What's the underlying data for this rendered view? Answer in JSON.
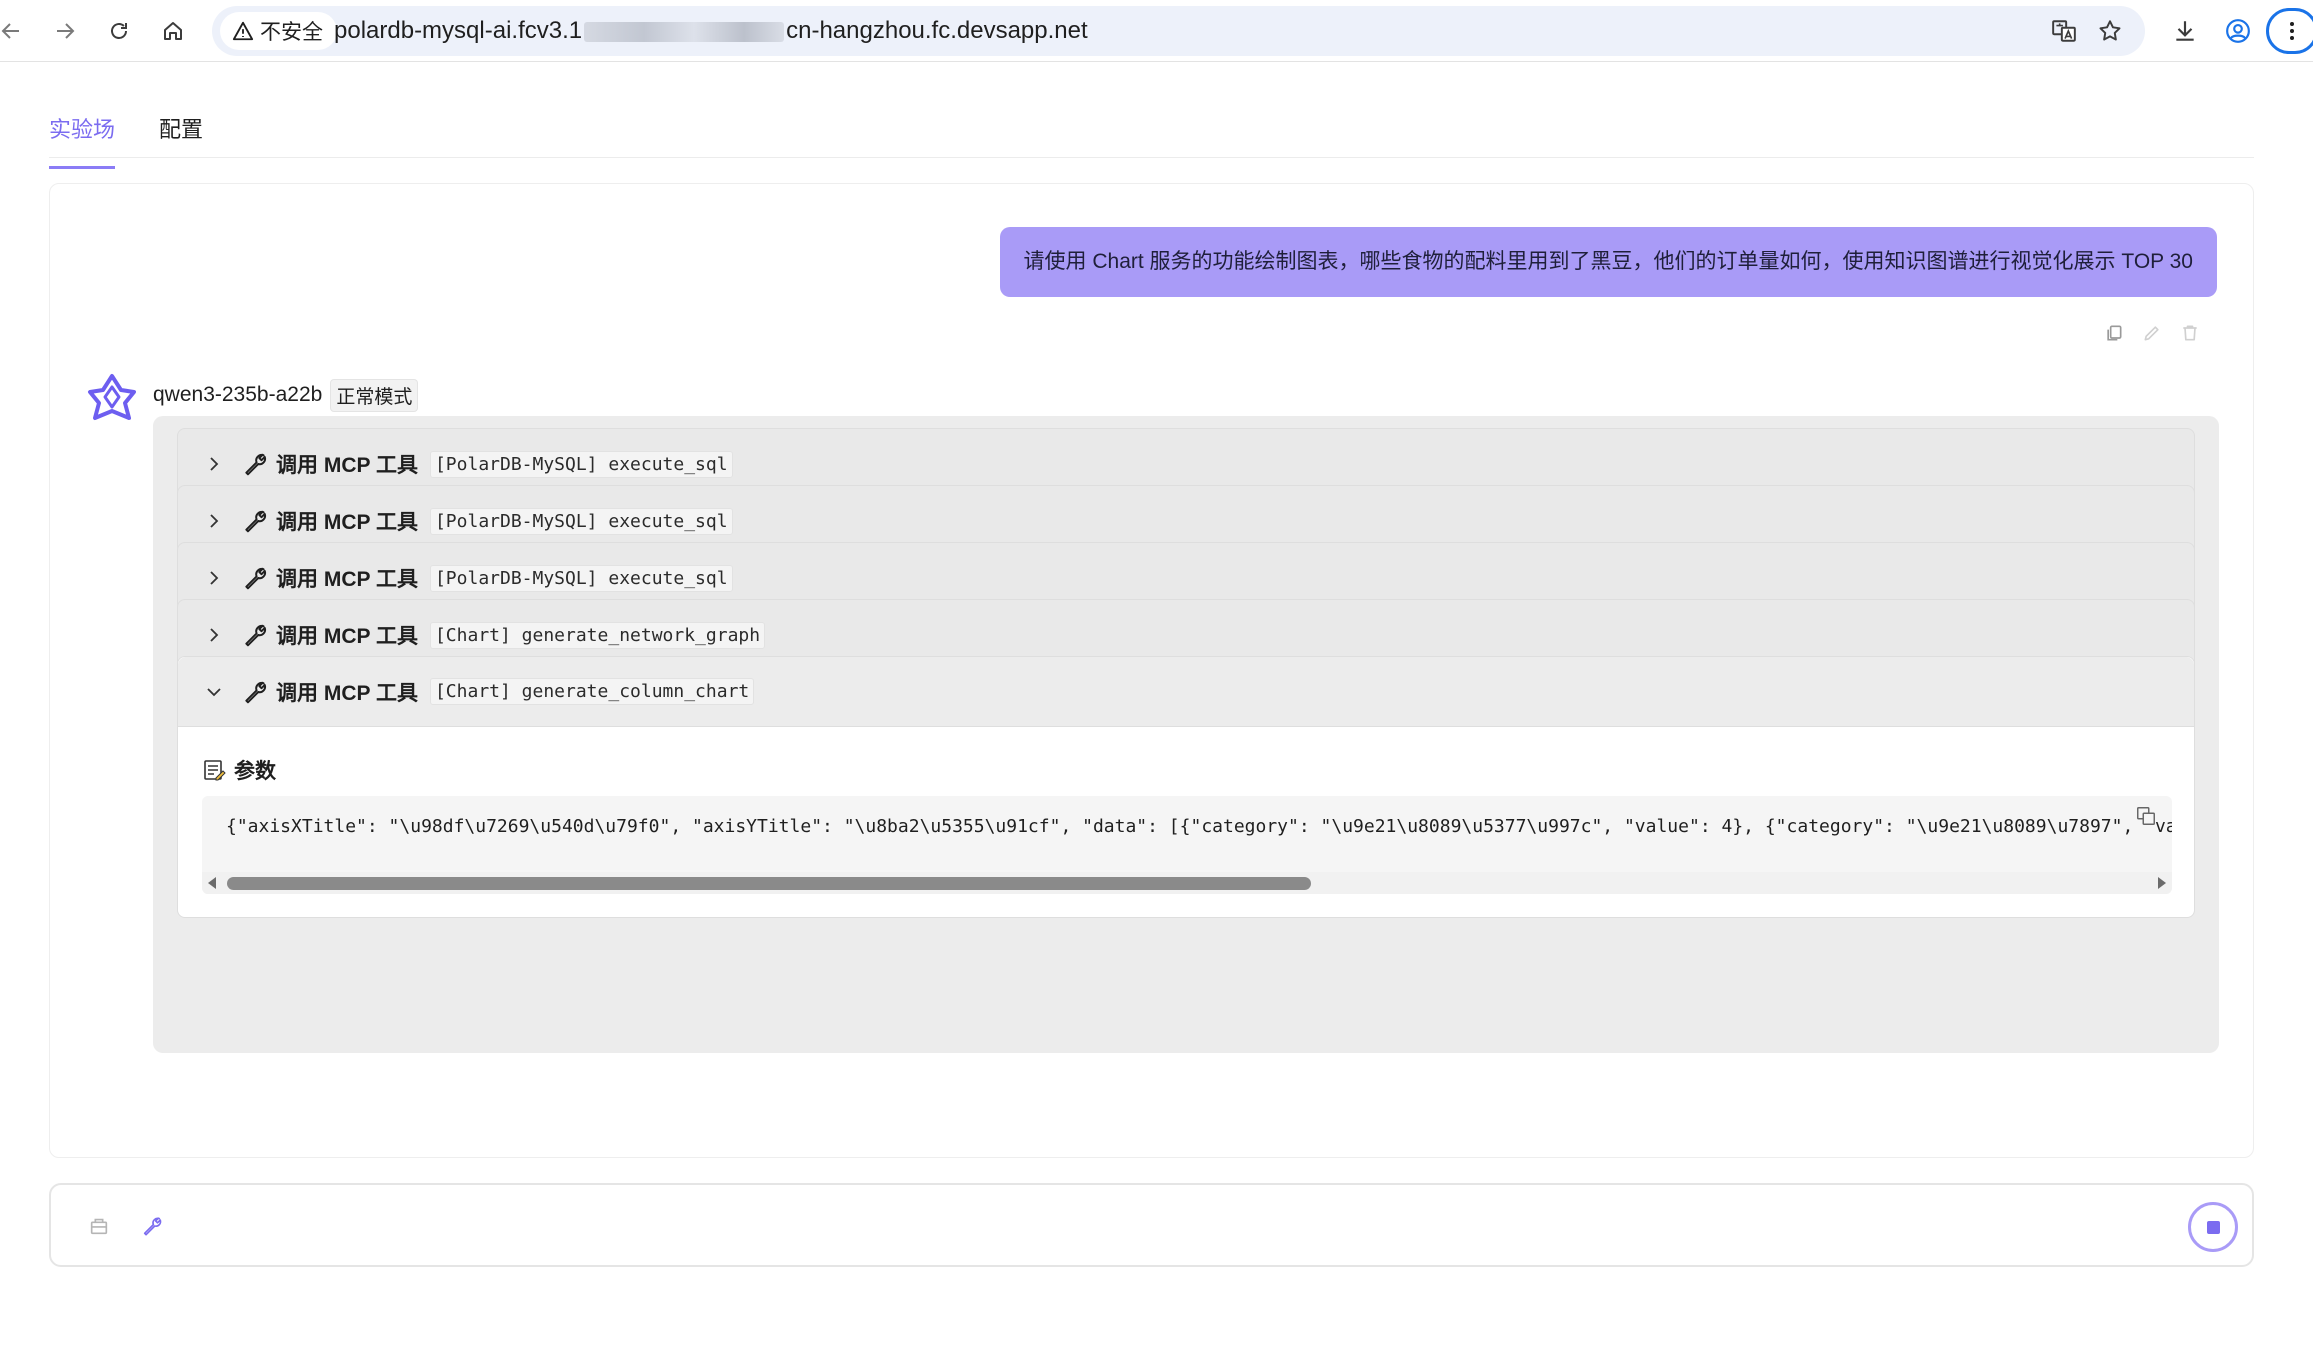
{
  "browser": {
    "security_label": "不安全",
    "url_prefix": "polardb-mysql-ai.fcv3.1",
    "url_suffix": "cn-hangzhou.fc.devsapp.net"
  },
  "tabs": [
    {
      "label": "实验场",
      "active": true
    },
    {
      "label": "配置",
      "active": false
    }
  ],
  "chat": {
    "user_message": "请使用 Chart 服务的功能绘制图表，哪些食物的配料里用到了黑豆，他们的订单量如何，使用知识图谱进行视觉化展示 TOP 30",
    "model_name": "qwen3-235b-a22b",
    "mode_badge": "正常模式",
    "tool_calls": [
      {
        "title": "调用 MCP 工具",
        "tool": "[PolarDB-MySQL] execute_sql",
        "expanded": false
      },
      {
        "title": "调用 MCP 工具",
        "tool": "[PolarDB-MySQL] execute_sql",
        "expanded": false
      },
      {
        "title": "调用 MCP 工具",
        "tool": "[PolarDB-MySQL] execute_sql",
        "expanded": false
      },
      {
        "title": "调用 MCP 工具",
        "tool": "[Chart] generate_network_graph",
        "expanded": false
      },
      {
        "title": "调用 MCP 工具",
        "tool": "[Chart] generate_column_chart",
        "expanded": true
      }
    ],
    "params_label": "参数",
    "params_code": "{\"axisXTitle\": \"\\u98df\\u7269\\u540d\\u79f0\", \"axisYTitle\": \"\\u8ba2\\u5355\\u91cf\", \"data\": [{\"category\": \"\\u9e21\\u8089\\u5377\\u997c\", \"value\": 4}, {\"category\": \"\\u9e21\\u8089\\u7897\", \"va"
  },
  "input": {
    "placeholder": "",
    "value": ""
  },
  "colors": {
    "accent": "#8b7cf6",
    "user_bubble": "#a99bf7",
    "tool_row_bg": "#e9e9e9"
  }
}
